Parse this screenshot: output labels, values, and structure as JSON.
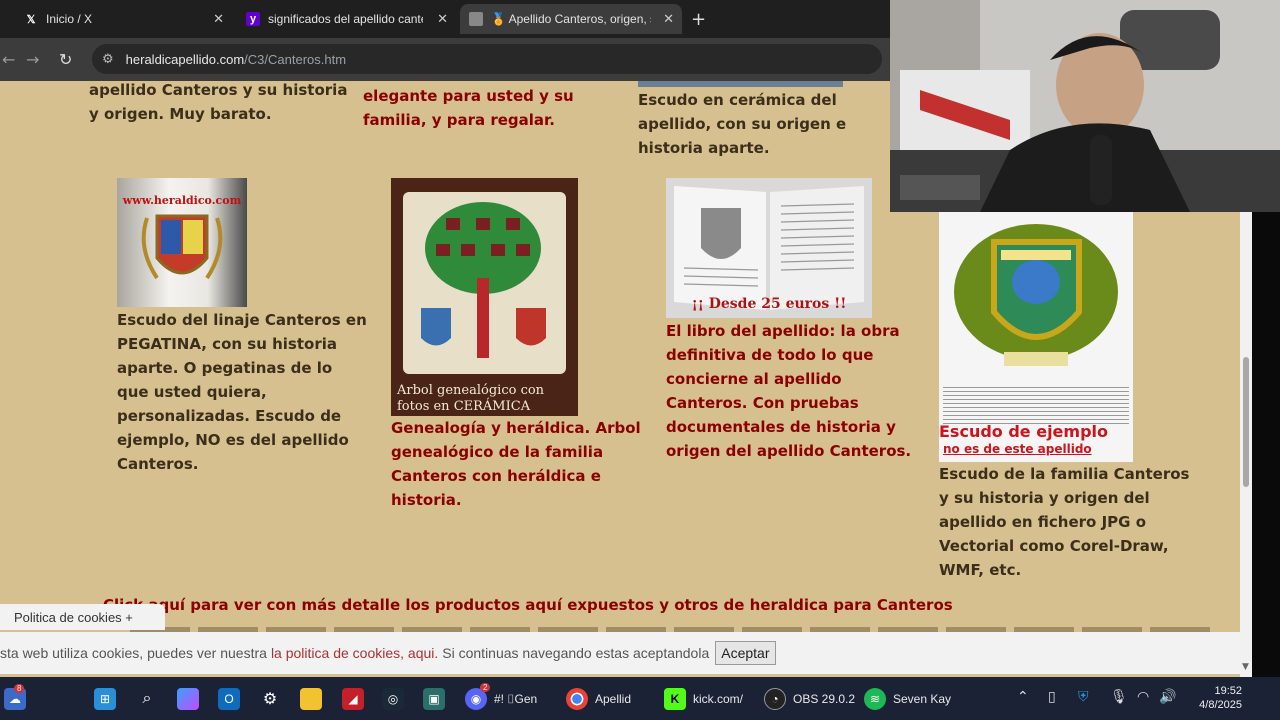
{
  "browser": {
    "tabs": [
      {
        "title": "Inicio / X",
        "icon": "x-logo-icon"
      },
      {
        "title": "significados del apellido canter",
        "icon": "yahoo-icon"
      },
      {
        "title": "🏅 Apellido Canteros, origen, s",
        "icon": "heraldry-favicon-icon"
      }
    ],
    "new_tab": "+",
    "url_host": "heraldicapellido.com",
    "url_path": "/C3/Canteros.htm"
  },
  "page": {
    "top_col1": "apellido Canteros y su historia y origen. Muy barato.",
    "top_col2": "elegante para usted y su familia, y para regalar.",
    "top_col3": "Escudo en cerámica del apellido, con su origen e historia aparte.",
    "products": [
      {
        "image_caption": "www.heraldico.com",
        "description": "Escudo del linaje Canteros en PEGATINA, con su historia aparte. O pegatinas de lo que usted quiera, personalizadas. Escudo de ejemplo, NO es del apellido Canteros."
      },
      {
        "image_caption": "Arbol genealógico con fotos en CERÁMICA",
        "description": "Genealogía y heráldica. Arbol genealógico de la familia Canteros con heráldica e historia."
      },
      {
        "image_caption": "¡¡ Desde 25 euros !!",
        "description": "El libro del apellido: la obra definitiva de todo lo que concierne al apellido Canteros. Con pruebas documentales de historia y origen del apellido Canteros."
      },
      {
        "image_caption": "Escudo de ejemplo",
        "image_subcaption": "no es de este apellido",
        "description": "Escudo de la familia Canteros y su historia y origen del apellido en fichero JPG o Vectorial como Corel-Draw, WMF, etc."
      }
    ],
    "click_link": "Click aquí para ver con más detalle los productos aquí expuestos y otros de heraldica para Canteros",
    "colors": {
      "background": "#d7c08f",
      "red_text": "#8b0000",
      "dark_text": "#3b2e1a"
    }
  },
  "cookie": {
    "tab_label": "Politica de cookies +",
    "text_before": "sta web utiliza cookies, puedes ver nuestra",
    "link": "la politica de cookies, aqui.",
    "text_after": "Si continuas navegando estas aceptandola",
    "accept": "Aceptar"
  },
  "taskbar": {
    "items": [
      {
        "label": "Apellid",
        "icon": "chrome-icon"
      },
      {
        "label": "kick.com/",
        "icon": "kick-icon"
      },
      {
        "label": "OBS 29.0.2",
        "icon": "obs-icon"
      },
      {
        "label": "Seven Kay",
        "icon": "spotify-icon"
      },
      {
        "label": "#! ⌷Gen",
        "icon": "discord-icon"
      }
    ],
    "discord_badge": "2",
    "weather_badge": "8",
    "time": "19:52",
    "date": "4/8/2025"
  }
}
